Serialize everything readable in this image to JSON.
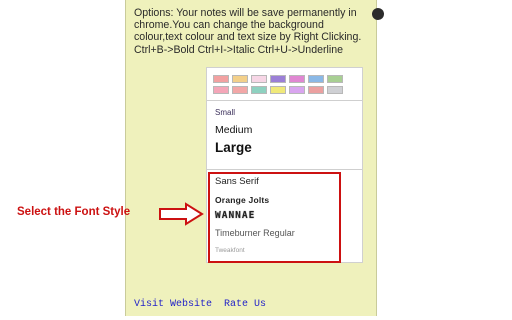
{
  "note": {
    "options_text": "Options: Your notes will be save permanently in chrome.You can change the background colour,text colour and text size by Right Clicking. Ctrl+B->Bold Ctrl+I->Italic Ctrl+U->Underline"
  },
  "menu": {
    "swatch_rows": [
      [
        "#f2a1a1",
        "#f3d08a",
        "#f7d6e6",
        "#9b7fd6",
        "#e087d2",
        "#8ab8e6",
        "#a8cf93"
      ],
      [
        "#f4a6b8",
        "#f2a7a7",
        "#8ed1c0",
        "#f0e97a",
        "#d9a5ef",
        "#eba0a0",
        "#cfd0d4"
      ]
    ],
    "sizes": [
      "Small",
      "Medium",
      "Large"
    ],
    "fonts": [
      "Sans Serif",
      "Orange Jolts",
      "WANNAE",
      "Timeburner Regular",
      "Tweakfont"
    ]
  },
  "callout": {
    "label": "Select the Font Style",
    "color": "#cc1111"
  },
  "footer": {
    "visit": "Visit Website",
    "rate": "Rate Us"
  }
}
